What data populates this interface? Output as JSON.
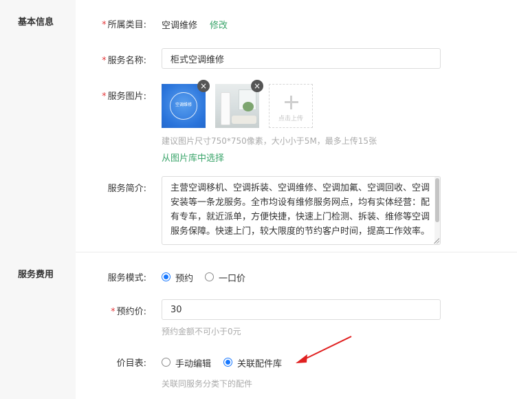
{
  "sections": {
    "basic_info": "基本信息",
    "service_fee": "服务费用"
  },
  "category": {
    "label": "所属类目:",
    "required_mark": "*",
    "value": "空调维修",
    "edit_link": "修改"
  },
  "service_name": {
    "label": "服务名称:",
    "required_mark": "*",
    "value": "柜式空调维修"
  },
  "service_images": {
    "label": "服务图片:",
    "required_mark": "*",
    "image1_caption": "空调维修",
    "image2_icon": "floor-ac-room-photo",
    "remove_glyph": "×",
    "upload_label": "点击上传",
    "hint": "建议图片尺寸750*750像素，大小小于5M，最多上传15张",
    "library_link": "从图片库中选择"
  },
  "service_intro": {
    "label": "服务简介:",
    "value": "主营空调移机、空调拆装、空调维修、空调加氟、空调回收、空调安装等一条龙服务。全市均设有维修服务网点，均有实体经营：配有专车，就近派单，方便快捷，快速上门检测、拆装、维修等空调服务保障。快速上门，较大限度的节约客户时间，提高工作效率。"
  },
  "service_mode": {
    "label": "服务模式:",
    "options": [
      "预约",
      "一口价"
    ],
    "selected": "预约"
  },
  "deposit_price": {
    "label": "预约价:",
    "required_mark": "*",
    "value": "30",
    "hint": "预约金额不可小于0元"
  },
  "price_list": {
    "label": "价目表:",
    "options": [
      "手动编辑",
      "关联配件库"
    ],
    "selected": "关联配件库",
    "hint": "关联同服务分类下的配件"
  },
  "annotation": {
    "arrow_color": "#e02020"
  },
  "colors": {
    "accent_green": "#3aa46a",
    "radio_blue": "#1677ff",
    "required_red": "#e4393c",
    "sidebar_bg": "#f7f7f7"
  }
}
